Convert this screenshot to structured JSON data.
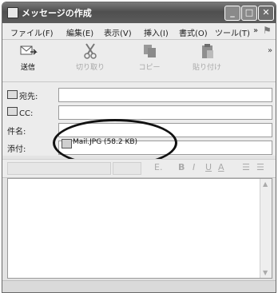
{
  "window": {
    "title": "メッセージの作成"
  },
  "menu": {
    "file": "ファイル(F)",
    "edit": "編集(E)",
    "view": "表示(V)",
    "insert": "挿入(I)",
    "format": "書式(O)",
    "tools": "ツール(T)",
    "more": "»"
  },
  "toolbar": {
    "send": "送信",
    "cut": "切り取り",
    "copy": "コピー",
    "paste": "貼り付け",
    "more": "»"
  },
  "fields": {
    "to_label": "宛先:",
    "cc_label": "CC:",
    "subject_label": "件名:",
    "attach_label": "添付:",
    "to_value": "",
    "cc_value": "",
    "subject_value": ""
  },
  "attachment": {
    "name": "Mail.JPG (58.2 KB)"
  },
  "format_bar": {
    "bold": "B",
    "italic": "I",
    "underline": "U",
    "color": "A"
  }
}
